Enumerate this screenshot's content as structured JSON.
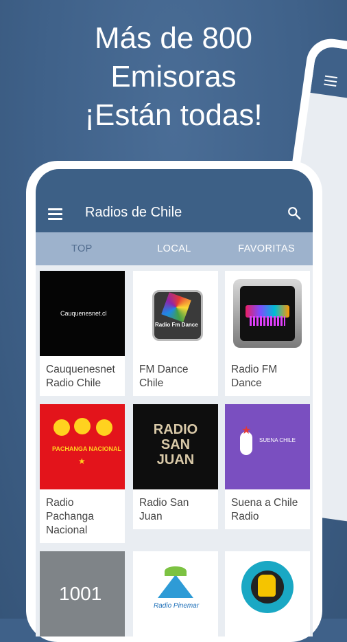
{
  "promo": {
    "line1": "Más de 800",
    "line2": "Emisoras",
    "line3": "¡Están todas!"
  },
  "app": {
    "title": "Radios de Chile"
  },
  "tabs": [
    {
      "label": "TOP",
      "active": true
    },
    {
      "label": "LOCAL",
      "active": false
    },
    {
      "label": "FAVORITAS",
      "active": false
    }
  ],
  "stations": [
    {
      "name": "Cauquenesnet\nRadio Chile",
      "logo_text": "Cauquenesnet.cl"
    },
    {
      "name": "FM Dance\nChile",
      "logo_text": "Radio Fm Dance"
    },
    {
      "name": "Radio FM\nDance",
      "logo_text": ""
    },
    {
      "name": "Radio\nPachanga\nNacional",
      "logo_text": "PACHANGA NACIONAL"
    },
    {
      "name": "Radio San\nJuan",
      "logo_text": "RADIO SAN JUAN"
    },
    {
      "name": "Suena a Chile\nRadio",
      "logo_text": "SUENA CHILE"
    },
    {
      "name": "",
      "logo_text": "1001"
    },
    {
      "name": "",
      "logo_text": "Radio Pinemar"
    },
    {
      "name": "",
      "logo_text": ""
    }
  ],
  "colors": {
    "background": "#3f6189",
    "appbar": "#3d6086",
    "tabbar": "#9db2cc",
    "active_tab": "#516c8e"
  }
}
